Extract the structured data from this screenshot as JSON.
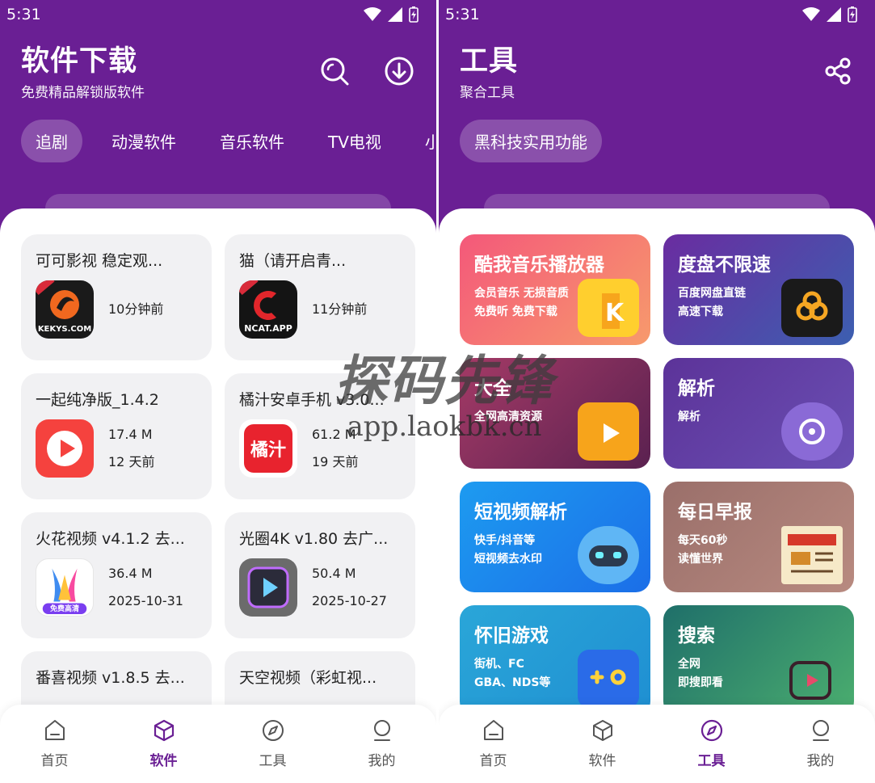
{
  "status": {
    "time": "5:31"
  },
  "colors": {
    "brand": "#6a1f94",
    "card_bg": "#f1f1f3"
  },
  "left": {
    "title": "软件下载",
    "subtitle": "免费精品解锁版软件",
    "tabs": [
      "追剧",
      "动漫软件",
      "音乐软件",
      "TV电视",
      "小"
    ],
    "apps": [
      {
        "name": "可可影视 稳定观...",
        "icon_label": "KEKYS.COM",
        "line1": "10分钟前",
        "line2": ""
      },
      {
        "name": "猫（请开启青...",
        "icon_label": "NCAT.APP",
        "line1": "11分钟前",
        "line2": ""
      },
      {
        "name": "一起纯净版_1.4.2",
        "icon_label": "",
        "line1": "17.4 M",
        "line2": "12 天前"
      },
      {
        "name": "橘汁安卓手机 v3.0...",
        "icon_label": "橘汁",
        "line1": "61.2 M",
        "line2": "19 天前"
      },
      {
        "name": "火花视频 v4.1.2 去...",
        "icon_label": "免费高清",
        "line1": "36.4 M",
        "line2": "2025-10-31"
      },
      {
        "name": "光圈4K v1.80 去广...",
        "icon_label": "",
        "line1": "50.4 M",
        "line2": "2025-10-27"
      },
      {
        "name": "番喜视频 v1.8.5 去...",
        "icon_label": "",
        "line1": "",
        "line2": ""
      },
      {
        "name": "天空视频（彩虹视...",
        "icon_label": "",
        "line1": "",
        "line2": ""
      }
    ],
    "nav": [
      "首页",
      "软件",
      "工具",
      "我的"
    ]
  },
  "right": {
    "title": "工具",
    "subtitle": "聚合工具",
    "tabs": [
      "黑科技实用功能"
    ],
    "tools": [
      {
        "title": "酷我音乐播放器",
        "desc1": "会员音乐 无损音质",
        "desc2": "免费听 免费下载"
      },
      {
        "title": "度盘不限速",
        "desc1": "百度网盘直链",
        "desc2": "高速下载"
      },
      {
        "title": "大全",
        "desc1": "",
        "desc2": "全网高清资源"
      },
      {
        "title": "解析",
        "desc1": "解析",
        "desc2": ""
      },
      {
        "title": "短视频解析",
        "desc1": "快手/抖音等",
        "desc2": "短视频去水印"
      },
      {
        "title": "每日早报",
        "desc1": "每天60秒",
        "desc2": "读懂世界"
      },
      {
        "title": "怀旧游戏",
        "desc1": "街机、FC",
        "desc2": "GBA、NDS等"
      },
      {
        "title": "搜索",
        "desc1": "全网",
        "desc2": "即搜即看"
      }
    ],
    "nav": [
      "首页",
      "软件",
      "工具",
      "我的"
    ]
  },
  "watermark": {
    "main": "探码先锋",
    "sub": "app.laokbk.cn"
  }
}
